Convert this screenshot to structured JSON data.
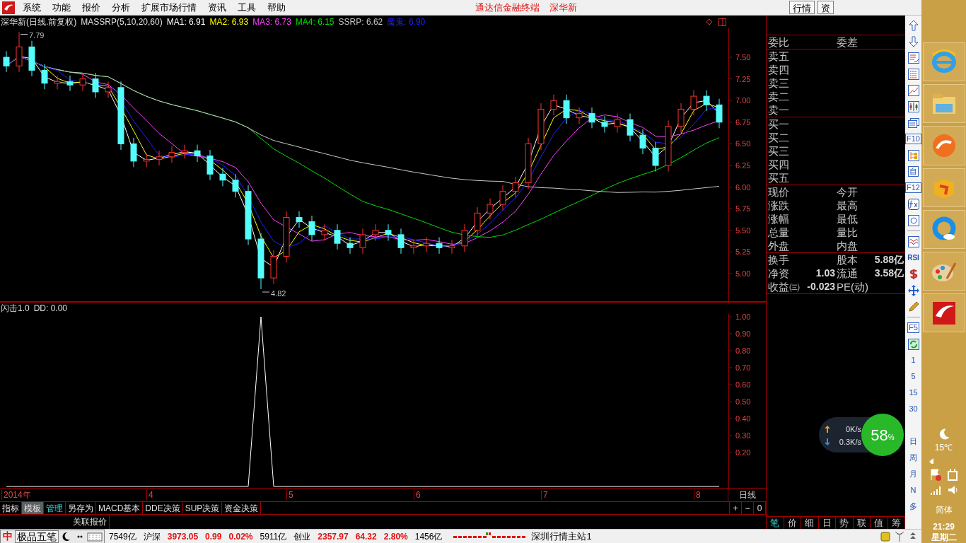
{
  "menu": {
    "items": [
      "系统",
      "功能",
      "报价",
      "分析",
      "扩展市场行情",
      "资讯",
      "工具",
      "帮助"
    ],
    "title": [
      "通达信金融终端",
      "深华新"
    ],
    "buttons": [
      "行情",
      "资"
    ]
  },
  "price_pane": {
    "stock": "深华新(日线.前复权)",
    "indicator": "MASSRP(5,10,20,60)",
    "legend": [
      {
        "text": "MA1: 6.91",
        "color": "#ffffff"
      },
      {
        "text": "MA2: 6.93",
        "color": "#ffff00"
      },
      {
        "text": "MA3: 6.73",
        "color": "#ff40ff"
      },
      {
        "text": "MA4: 6.15",
        "color": "#00e000"
      },
      {
        "text": "SSRP: 6.62",
        "color": "#c8c8c8"
      },
      {
        "text": "魔鬼: 6.90",
        "color": "#2020ff"
      }
    ],
    "y_axis_labels": [
      "7.50",
      "7.25",
      "7.00",
      "6.75",
      "6.50",
      "6.25",
      "6.00",
      "5.75",
      "5.50",
      "5.25",
      "5.00"
    ],
    "extreme_labels": [
      "7.79",
      "4.82"
    ]
  },
  "indicator_pane": {
    "title": "闪击1.0",
    "reading": "DD: 0.00",
    "y_axis_labels": [
      "1.00",
      "0.90",
      "0.80",
      "0.70",
      "0.60",
      "0.50",
      "0.40",
      "0.30",
      "0.20"
    ]
  },
  "x_axis": {
    "labels": [
      "2014年",
      "4",
      "5",
      "6",
      "7",
      "8"
    ],
    "period": "日线"
  },
  "template_tabs": [
    {
      "label": "指标",
      "selected": false,
      "kind": "normal"
    },
    {
      "label": "模板",
      "selected": true,
      "kind": "normal"
    },
    {
      "label": "管理",
      "selected": false,
      "kind": "accent"
    },
    {
      "label": "另存为",
      "selected": false,
      "kind": "normal"
    },
    {
      "label": "MACD基本",
      "selected": false,
      "kind": "normal"
    },
    {
      "label": "DDE决策",
      "selected": false,
      "kind": "normal"
    },
    {
      "label": "SUP决策",
      "selected": false,
      "kind": "normal"
    },
    {
      "label": "资金决策",
      "selected": false,
      "kind": "normal"
    }
  ],
  "zoom_buttons": [
    "+",
    "−",
    "0"
  ],
  "lower_tabs": [
    "关联报价"
  ],
  "quote_panel": {
    "ratio": [
      "委比",
      "委差"
    ],
    "sell": [
      "卖五",
      "卖四",
      "卖三",
      "卖二",
      "卖一"
    ],
    "buy": [
      "买一",
      "买二",
      "买三",
      "买四",
      "买五"
    ],
    "stats": [
      [
        "现价",
        "今开"
      ],
      [
        "涨跌",
        "最高"
      ],
      [
        "涨幅",
        "最低"
      ],
      [
        "总量",
        "量比"
      ],
      [
        "外盘",
        "内盘"
      ]
    ],
    "fundamentals": [
      [
        {
          "label": "换手"
        },
        {
          "label": "股本",
          "value": "5.88亿"
        }
      ],
      [
        {
          "label": "净资",
          "value": "1.03"
        },
        {
          "label": "流通",
          "value": "3.58亿"
        }
      ],
      [
        {
          "label": "收益㈢",
          "value": "-0.023"
        },
        {
          "label": "PE(动)"
        }
      ]
    ],
    "tabs": [
      {
        "label": "笔",
        "selected": true
      },
      {
        "label": "价",
        "selected": false
      },
      {
        "label": "细",
        "selected": false
      },
      {
        "label": "日",
        "selected": false
      },
      {
        "label": "势",
        "selected": false
      },
      {
        "label": "联",
        "selected": false
      },
      {
        "label": "值",
        "selected": false
      },
      {
        "label": "筹",
        "selected": false
      }
    ]
  },
  "toolbar_texts": [
    "F10",
    "自",
    "F12",
    "RSI",
    "F5",
    "1",
    "5",
    "15",
    "30",
    "日",
    "周",
    "月",
    "N",
    "多"
  ],
  "network": {
    "upload": "0K/s",
    "download": "0.3K/s",
    "percent": "58",
    "unit": "%"
  },
  "ime": {
    "logo": "中",
    "name": "极品五笔"
  },
  "status": [
    {
      "text": "7549亿",
      "kind": "label"
    },
    {
      "text": "沪深",
      "kind": "label"
    },
    {
      "text": "3973.05",
      "kind": "value"
    },
    {
      "text": "0.99",
      "kind": "value"
    },
    {
      "text": "0.02%",
      "kind": "value"
    },
    {
      "text": "5911亿",
      "kind": "label"
    },
    {
      "text": "创业",
      "kind": "label"
    },
    {
      "text": "2357.97",
      "kind": "value"
    },
    {
      "text": "64.32",
      "kind": "value"
    },
    {
      "text": "2.80%",
      "kind": "value"
    },
    {
      "text": "1456亿",
      "kind": "label"
    }
  ],
  "server": "深圳行情主站1",
  "taskbar": {
    "temperature": "15℃",
    "language": "简体",
    "time": "21:29",
    "weekday": "星期二"
  }
}
